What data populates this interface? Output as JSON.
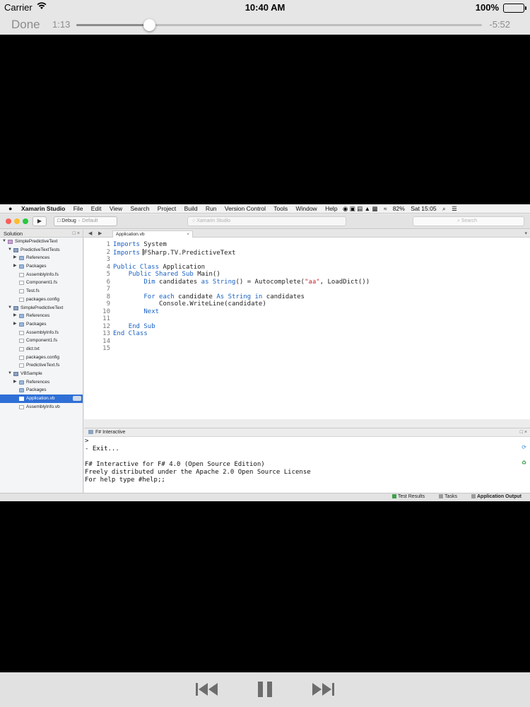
{
  "status_bar": {
    "carrier": "Carrier",
    "time": "10:40 AM",
    "battery": "100%"
  },
  "player": {
    "done_label": "Done",
    "elapsed": "1:13",
    "remaining": "-5:52",
    "progress": 0.18
  },
  "mac_menubar": {
    "app_name": "Xamarin Studio",
    "menus": [
      "File",
      "Edit",
      "View",
      "Search",
      "Project",
      "Build",
      "Run",
      "Version Control",
      "Tools",
      "Window",
      "Help"
    ],
    "battery": "82%",
    "clock": "Sat 15:05"
  },
  "toolbar": {
    "configuration": "Debug",
    "target": "Default",
    "status_text": "Xamarin Studio",
    "search_placeholder": "Search"
  },
  "solution": {
    "title": "Solution",
    "items": [
      {
        "label": "SimplePredictiveText",
        "depth": 0,
        "kind": "sln",
        "expanded": true
      },
      {
        "label": "PredictiveTextTests",
        "depth": 1,
        "kind": "proj",
        "expanded": true
      },
      {
        "label": "References",
        "depth": 2,
        "kind": "folder",
        "expanded": false
      },
      {
        "label": "Packages",
        "depth": 2,
        "kind": "folder",
        "expanded": false
      },
      {
        "label": "AssemblyInfo.fs",
        "depth": 2,
        "kind": "file"
      },
      {
        "label": "Component1.fs",
        "depth": 2,
        "kind": "file"
      },
      {
        "label": "Test.fs",
        "depth": 2,
        "kind": "file"
      },
      {
        "label": "packages.config",
        "depth": 2,
        "kind": "file"
      },
      {
        "label": "SimplePredictiveText",
        "depth": 1,
        "kind": "proj",
        "expanded": true
      },
      {
        "label": "References",
        "depth": 2,
        "kind": "folder",
        "expanded": false
      },
      {
        "label": "Packages",
        "depth": 2,
        "kind": "folder",
        "expanded": false
      },
      {
        "label": "AssemblyInfo.fs",
        "depth": 2,
        "kind": "file"
      },
      {
        "label": "Component1.fs",
        "depth": 2,
        "kind": "file"
      },
      {
        "label": "dict.txt",
        "depth": 2,
        "kind": "file"
      },
      {
        "label": "packages.config",
        "depth": 2,
        "kind": "file"
      },
      {
        "label": "PredictiveText.fs",
        "depth": 2,
        "kind": "file"
      },
      {
        "label": "VBSample",
        "depth": 1,
        "kind": "proj",
        "expanded": true
      },
      {
        "label": "References",
        "depth": 2,
        "kind": "folder",
        "expanded": false
      },
      {
        "label": "Packages",
        "depth": 2,
        "kind": "folder"
      },
      {
        "label": "Application.vb",
        "depth": 2,
        "kind": "file",
        "selected": true
      },
      {
        "label": "AssemblyInfo.vb",
        "depth": 2,
        "kind": "file"
      }
    ]
  },
  "editor": {
    "tab_label": "Application.vb",
    "lines": [
      {
        "n": "1",
        "segs": [
          [
            "kw",
            "Imports"
          ],
          [
            "",
            " System"
          ]
        ]
      },
      {
        "n": "2",
        "segs": [
          [
            "kw",
            "Imports"
          ],
          [
            "",
            " "
          ],
          [
            "caret",
            ""
          ],
          [
            "",
            "FSharp.TV.PredictiveText"
          ]
        ]
      },
      {
        "n": "3",
        "segs": []
      },
      {
        "n": "4",
        "segs": [
          [
            "kw",
            "Public Class"
          ],
          [
            "",
            " Application"
          ]
        ]
      },
      {
        "n": "5",
        "segs": [
          [
            "",
            "    "
          ],
          [
            "kw",
            "Public Shared Sub"
          ],
          [
            "",
            " Main()"
          ]
        ]
      },
      {
        "n": "6",
        "segs": [
          [
            "",
            "        "
          ],
          [
            "kw",
            "Dim"
          ],
          [
            "",
            " candidates "
          ],
          [
            "kw",
            "as String"
          ],
          [
            "",
            "() = Autocomplete("
          ],
          [
            "str",
            "\"aa\""
          ],
          [
            "",
            ", LoadDict())"
          ]
        ]
      },
      {
        "n": "7",
        "segs": []
      },
      {
        "n": "8",
        "segs": [
          [
            "",
            "        "
          ],
          [
            "kw",
            "For each"
          ],
          [
            "",
            " candidate "
          ],
          [
            "kw",
            "As String in"
          ],
          [
            "",
            " candidates"
          ]
        ]
      },
      {
        "n": "9",
        "segs": [
          [
            "",
            "            Console.WriteLine(candidate)"
          ]
        ]
      },
      {
        "n": "10",
        "segs": [
          [
            "",
            "        "
          ],
          [
            "kw",
            "Next"
          ]
        ]
      },
      {
        "n": "11",
        "segs": []
      },
      {
        "n": "12",
        "segs": [
          [
            "",
            "    "
          ],
          [
            "kw",
            "End Sub"
          ]
        ]
      },
      {
        "n": "13",
        "segs": [
          [
            "kw",
            "End Class"
          ]
        ]
      },
      {
        "n": "14",
        "segs": []
      },
      {
        "n": "15",
        "segs": []
      }
    ]
  },
  "fsi": {
    "title": "F# Interactive",
    "lines": [
      ">",
      "- Exit...",
      "",
      "F# Interactive for F# 4.0 (Open Source Edition)",
      "Freely distributed under the Apache 2.0 Open Source License",
      "For help type #help;;"
    ]
  },
  "ide_status": {
    "pads": [
      {
        "label": "Test Results",
        "icon": "green"
      },
      {
        "label": "Tasks",
        "icon": "gray"
      },
      {
        "label": "Application Output",
        "icon": "gray",
        "active": true
      }
    ]
  },
  "colors": {
    "keyword": "#1a62c2",
    "string": "#c3272f",
    "selection": "#2f6fd6"
  }
}
